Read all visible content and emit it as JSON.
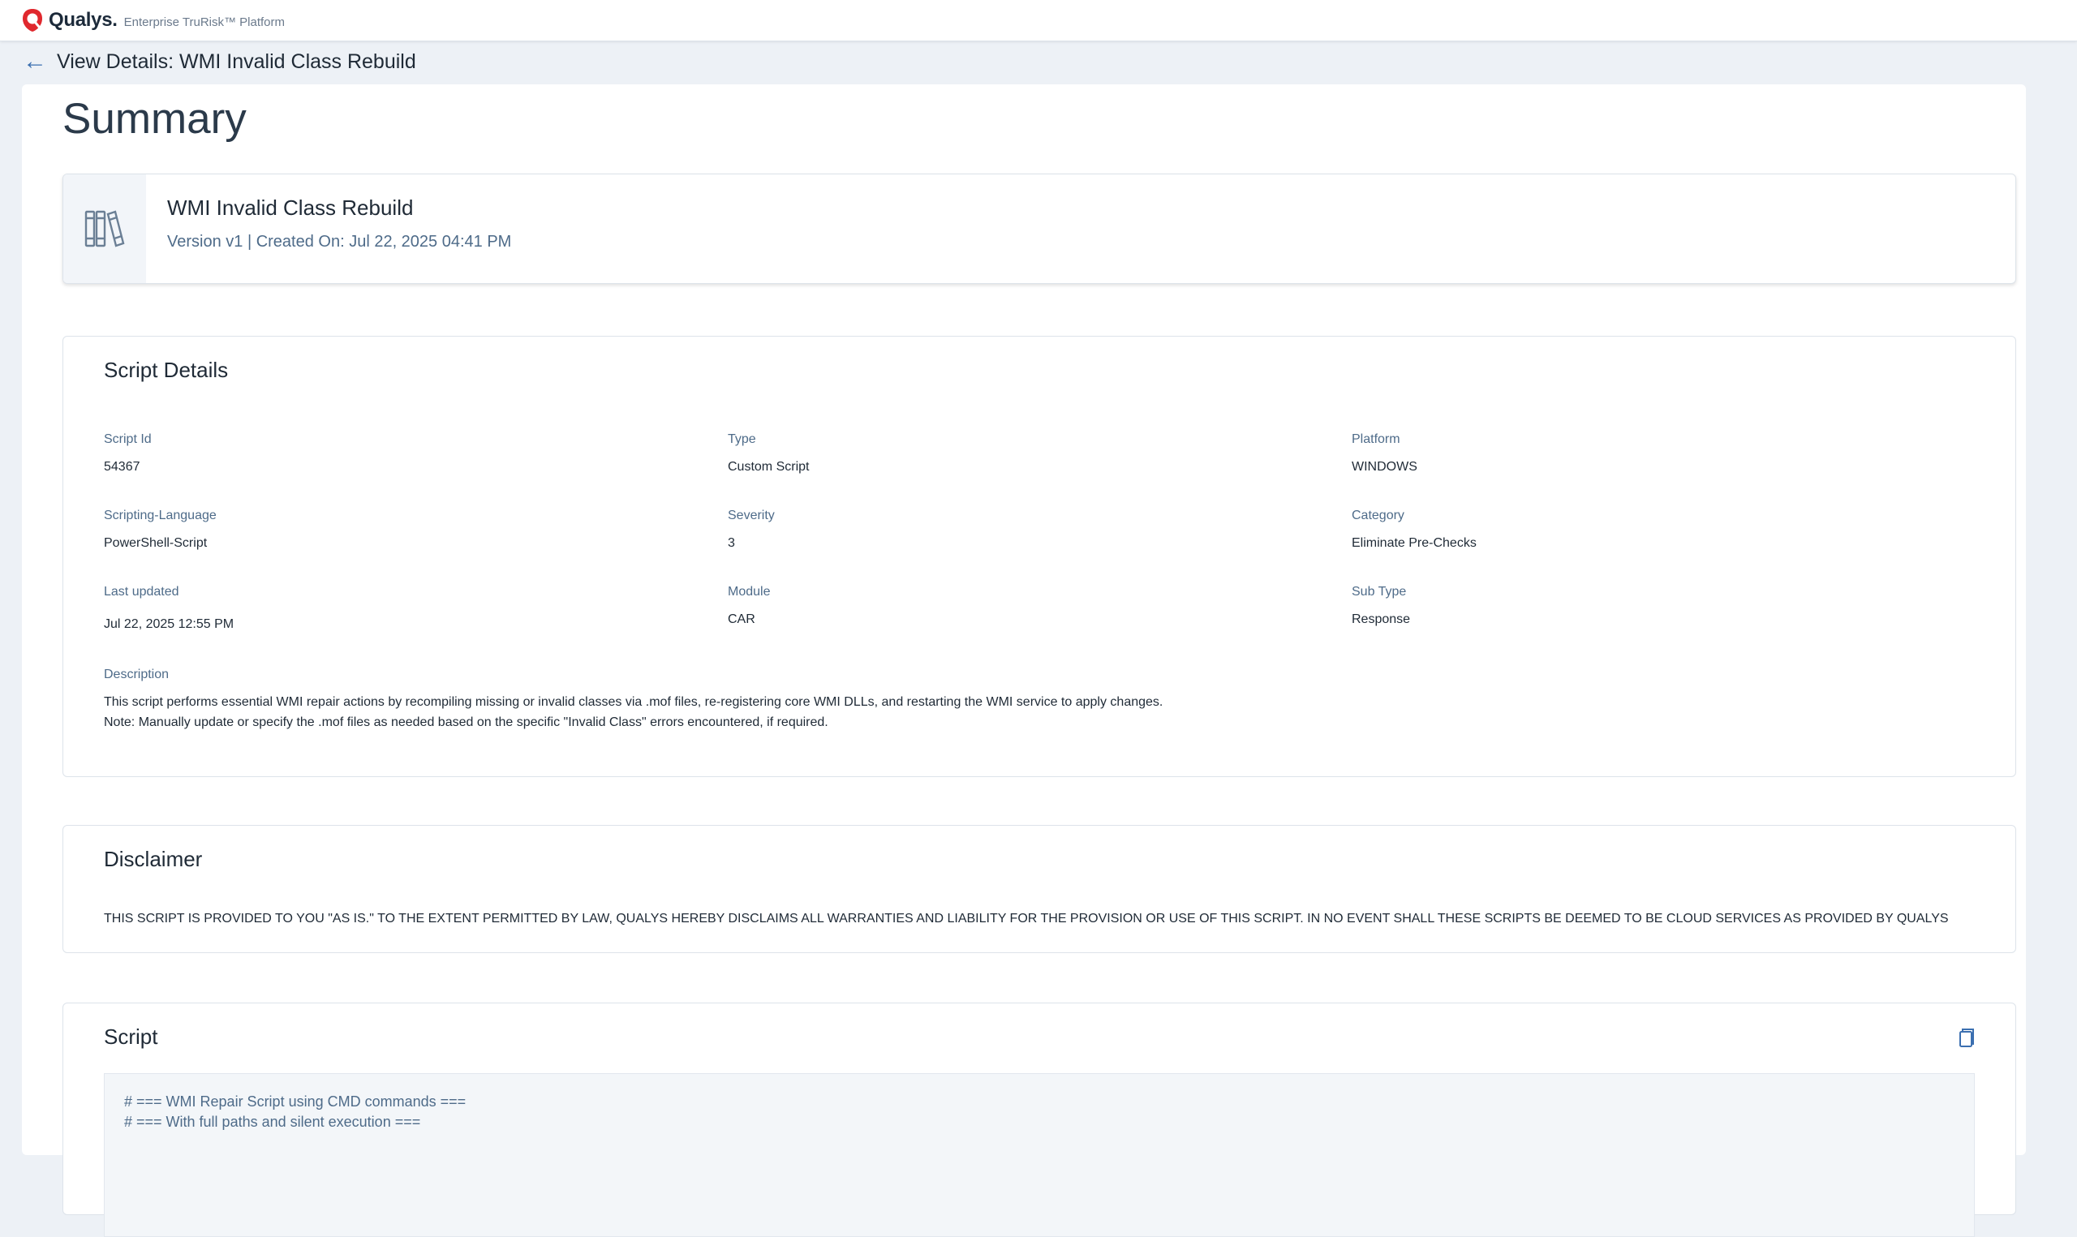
{
  "brand": {
    "name": "Qualys.",
    "tagline": "Enterprise TruRisk™ Platform"
  },
  "header": {
    "title": "View Details: WMI Invalid Class Rebuild"
  },
  "summary": {
    "heading": "Summary",
    "script_name": "WMI Invalid Class Rebuild",
    "meta": "Version v1 | Created On: Jul 22, 2025 04:41 PM"
  },
  "script_details": {
    "title": "Script Details",
    "fields": [
      {
        "label": "Script Id",
        "value": "54367"
      },
      {
        "label": "Type",
        "value": "Custom Script"
      },
      {
        "label": "Platform",
        "value": "WINDOWS"
      },
      {
        "label": "Scripting-Language",
        "value": "PowerShell-Script"
      },
      {
        "label": "Severity",
        "value": "3"
      },
      {
        "label": "Category",
        "value": "Eliminate Pre-Checks"
      },
      {
        "label": "Last updated",
        "value": "Jul 22, 2025 12:55 PM"
      },
      {
        "label": "Module",
        "value": "CAR"
      },
      {
        "label": "Sub Type",
        "value": "Response"
      }
    ],
    "description_label": "Description",
    "description_lines": [
      "This script performs essential WMI repair actions by recompiling missing or invalid classes via .mof files, re-registering core WMI DLLs, and restarting the WMI service to apply changes.",
      "Note: Manually update or specify the .mof files as needed based on the specific \"Invalid Class\" errors encountered, if required."
    ]
  },
  "disclaimer": {
    "title": "Disclaimer",
    "text": "THIS SCRIPT IS PROVIDED TO YOU \"AS IS.\" TO THE EXTENT PERMITTED BY LAW, QUALYS HEREBY DISCLAIMS ALL WARRANTIES AND LIABILITY FOR THE PROVISION OR USE OF THIS SCRIPT. IN NO EVENT SHALL THESE SCRIPTS BE DEEMED TO BE CLOUD SERVICES AS PROVIDED BY QUALYS"
  },
  "script": {
    "title": "Script",
    "lines": [
      "# === WMI Repair Script using CMD commands ===",
      "# === With full paths and silent execution ==="
    ]
  },
  "colors": {
    "brand_red": "#e0282e",
    "accent_blue": "#3b6fb0",
    "label_blue": "#4e6b89"
  }
}
